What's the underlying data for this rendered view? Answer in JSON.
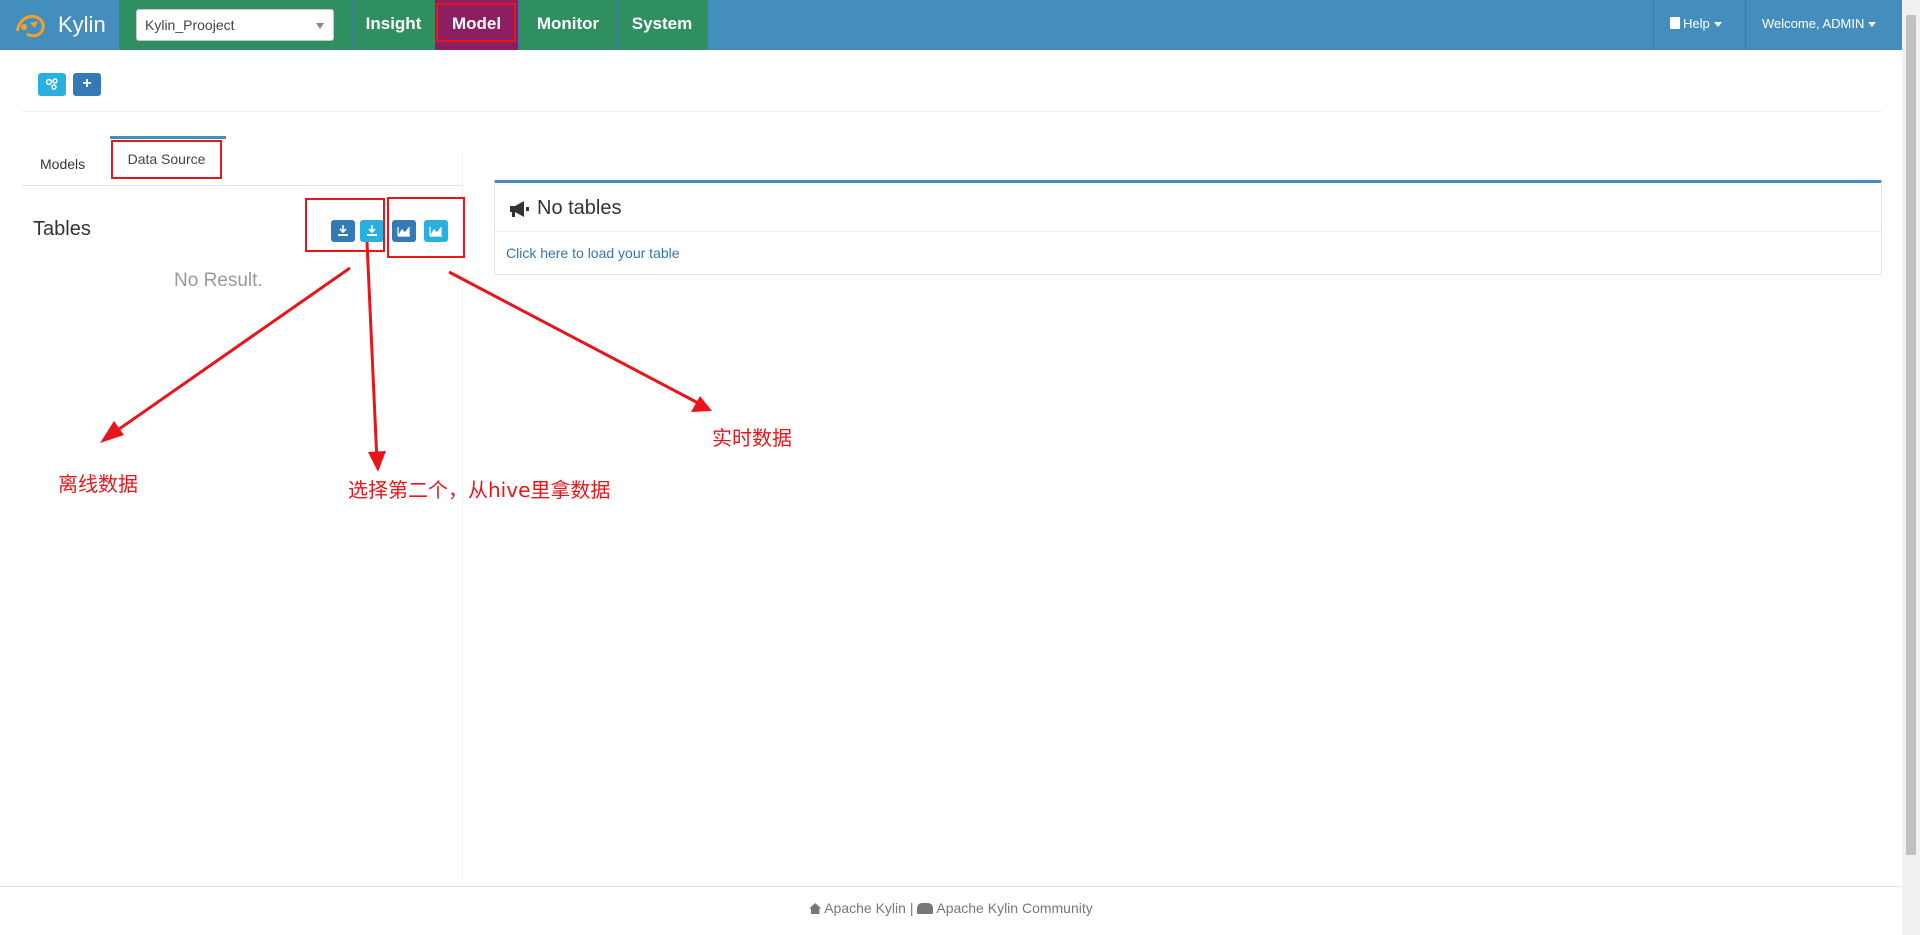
{
  "nav": {
    "brand": "Kylin",
    "project": "Kylin_Prooject",
    "items": [
      "Insight",
      "Model",
      "Monitor",
      "System"
    ],
    "active": "Model",
    "help": "Help",
    "welcome": "Welcome, ADMIN"
  },
  "toolbar": {
    "icons": [
      "sitemap-icon",
      "plus-icon"
    ]
  },
  "tabs": [
    "Models",
    "Data Source"
  ],
  "tables": {
    "title": "Tables",
    "empty": "No Result.",
    "buttons": [
      "load-table-icon",
      "load-hive-table-icon",
      "streaming-icon",
      "streaming-config-icon"
    ]
  },
  "panel": {
    "title": "No tables",
    "link": "Click here to load your table"
  },
  "annotations": {
    "offline": "离线数据",
    "hive": "选择第二个，从hive里拿数据",
    "realtime": "实时数据"
  },
  "footer": {
    "left": "Apache Kylin",
    "sep": "|",
    "right": "Apache Kylin Community"
  },
  "colors": {
    "navbar": "#448ebd",
    "nav_green": "#2f8f60",
    "active": "#8d1e5f",
    "annotation": "#e8161b",
    "btn_info": "#29b0e3",
    "btn_primary": "#337ab7"
  }
}
